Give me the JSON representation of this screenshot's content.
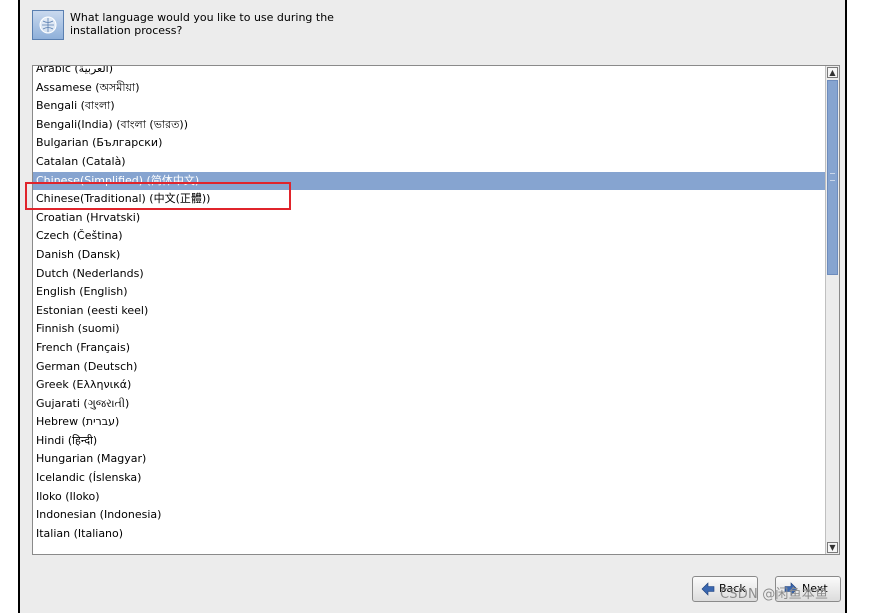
{
  "header": {
    "question": "What language would you like to use during the installation process?",
    "icon": "globe-flag-icon"
  },
  "languages": [
    "Arabic (العربية)",
    "Assamese (অসমীয়া)",
    "Bengali (বাংলা)",
    "Bengali(India) (বাংলা (ভারত))",
    "Bulgarian (Български)",
    "Catalan (Català)",
    "Chinese(Simplified) (简体中文)",
    "Chinese(Traditional) (中文(正體))",
    "Croatian (Hrvatski)",
    "Czech (Čeština)",
    "Danish (Dansk)",
    "Dutch (Nederlands)",
    "English (English)",
    "Estonian (eesti keel)",
    "Finnish (suomi)",
    "French (Français)",
    "German (Deutsch)",
    "Greek (Ελληνικά)",
    "Gujarati (ગુજરાતી)",
    "Hebrew (עברית)",
    "Hindi (हिन्दी)",
    "Hungarian (Magyar)",
    "Icelandic (Íslenska)",
    "Iloko (Iloko)",
    "Indonesian (Indonesia)",
    "Italian (Italiano)"
  ],
  "selected_index": 6,
  "buttons": {
    "back_label": "Back",
    "next_label": "Next"
  },
  "watermark": "CSDN @闲鱼本鱼",
  "colors": {
    "selection": "#86a4d0",
    "highlight_box": "#e0242b",
    "window_bg": "#ececec"
  }
}
